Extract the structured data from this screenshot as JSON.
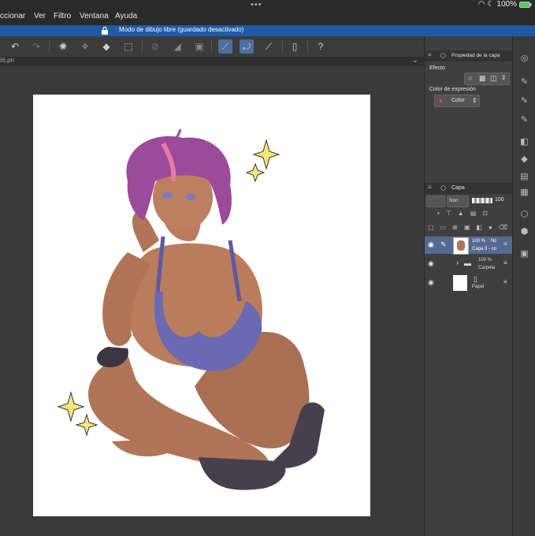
{
  "status": {
    "battery": "100%"
  },
  "menu": {
    "items": [
      "ccionar",
      "Ver",
      "Filtro",
      "Ventana",
      "Ayuda"
    ]
  },
  "infobar": {
    "text": "Modo de dibujo libre (guardado desactivado)"
  },
  "tab": {
    "filename": "66.pn"
  },
  "panels": {
    "property": {
      "title": "Propiedad de la capa",
      "effect_label": "Efecto",
      "expression_label": "Color de expresión",
      "expression_value": "Color"
    },
    "layer": {
      "title": "Capa",
      "blend_mode": "Norr",
      "opacity": "100"
    },
    "layers": [
      {
        "opacity": "100 %",
        "mode": "Nc",
        "name": "Capa 3 - co"
      },
      {
        "opacity": "100 %",
        "name": "Carpeta"
      },
      {
        "name": "Papel"
      }
    ]
  },
  "colors": {
    "accent": "#1f5aa6",
    "active_tool": "#4c6fa0",
    "panel": "#3f3f3f"
  }
}
